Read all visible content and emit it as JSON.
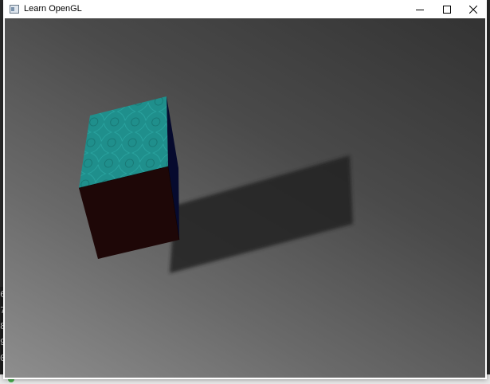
{
  "window": {
    "title": "Learn OpenGL",
    "icon": "opengl-app-icon",
    "controls": [
      "minimize-icon",
      "maximize-icon",
      "close-icon"
    ]
  },
  "scene": {
    "objects": [
      "textured-cube",
      "cube-shadow"
    ],
    "colors": {
      "cube_top": "#1f8f8c",
      "cube_front": "#1e0707",
      "cube_side": "#060a2e",
      "shadow": "#222222"
    }
  },
  "background_app": {
    "lines": [
      "6",
      "7",
      "8",
      "9",
      "0"
    ]
  }
}
